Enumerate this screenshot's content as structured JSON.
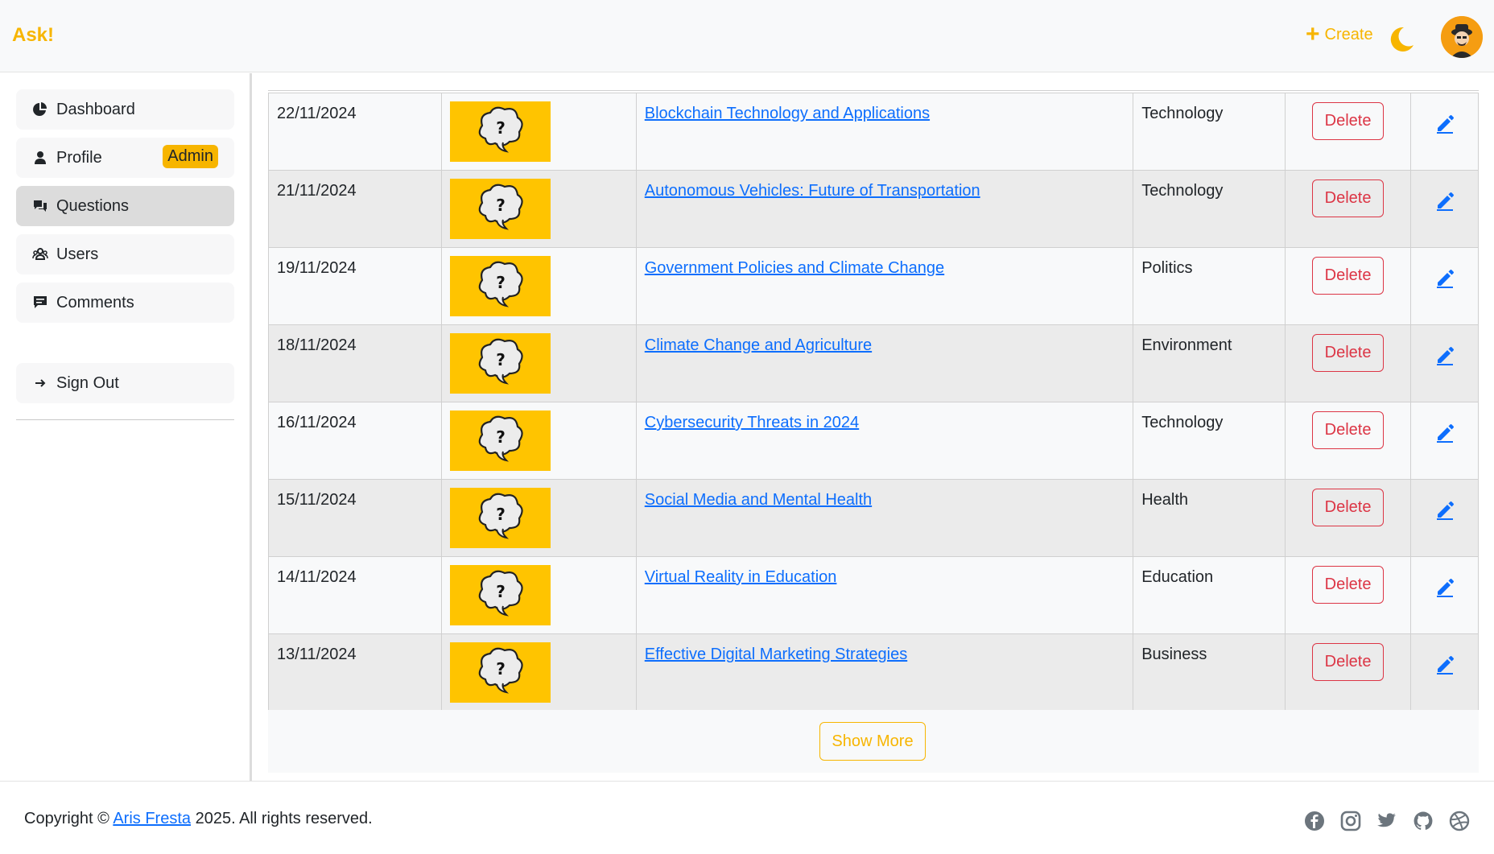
{
  "header": {
    "brand": "Ask!",
    "create_label": "Create",
    "accent": "#f7b500"
  },
  "sidebar": {
    "items": [
      {
        "label": "Dashboard",
        "icon": "pie-chart-icon"
      },
      {
        "label": "Profile",
        "icon": "user-icon",
        "badge": "Admin"
      },
      {
        "label": "Questions",
        "icon": "chat-bubbles-icon",
        "active": true
      },
      {
        "label": "Users",
        "icon": "group-icon"
      },
      {
        "label": "Comments",
        "icon": "comment-icon"
      }
    ],
    "signout_label": "Sign Out"
  },
  "table": {
    "rows": [
      {
        "date": "22/11/2024",
        "title": "Blockchain Technology and Applications",
        "category": "Technology"
      },
      {
        "date": "21/11/2024",
        "title": "Autonomous Vehicles: Future of Transportation",
        "category": "Technology"
      },
      {
        "date": "19/11/2024",
        "title": "Government Policies and Climate Change",
        "category": "Politics"
      },
      {
        "date": "18/11/2024",
        "title": "Climate Change and Agriculture",
        "category": "Environment"
      },
      {
        "date": "16/11/2024",
        "title": "Cybersecurity Threats in 2024",
        "category": "Technology"
      },
      {
        "date": "15/11/2024",
        "title": "Social Media and Mental Health",
        "category": "Health"
      },
      {
        "date": "14/11/2024",
        "title": "Virtual Reality in Education",
        "category": "Education"
      },
      {
        "date": "13/11/2024",
        "title": "Effective Digital Marketing Strategies",
        "category": "Business"
      }
    ],
    "delete_label": "Delete",
    "show_more_label": "Show More"
  },
  "footer": {
    "copyright_prefix": "Copyright ©",
    "author": "Aris Fresta",
    "copyright_suffix": "2025. All rights reserved.",
    "social_icons": [
      "facebook-icon",
      "instagram-icon",
      "twitter-icon",
      "github-icon",
      "dribbble-icon"
    ]
  }
}
